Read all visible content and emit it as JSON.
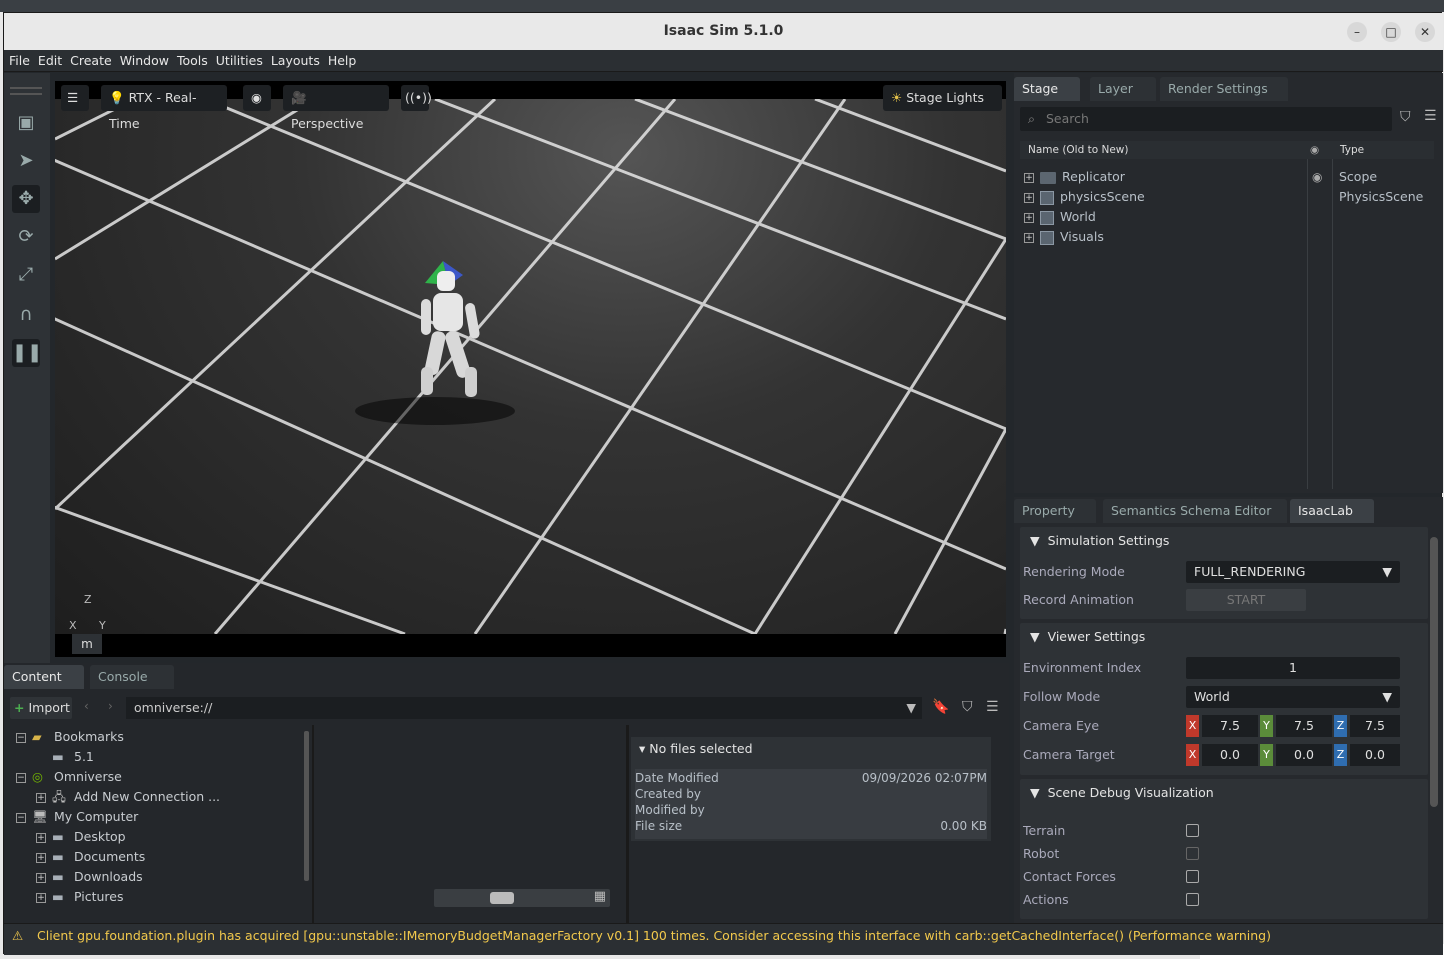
{
  "window": {
    "title": "Isaac Sim 5.1.0"
  },
  "menu": [
    "File",
    "Edit",
    "Create",
    "Window",
    "Tools",
    "Utilities",
    "Layouts",
    "Help"
  ],
  "viewport": {
    "render_mode": "RTX - Real-Time",
    "camera": "Perspective",
    "lights": "Stage Lights",
    "units": "m",
    "axes": {
      "z": "Z",
      "x": "X",
      "y": "Y"
    }
  },
  "stage": {
    "tabs": [
      "Stage",
      "Layer",
      "Render Settings"
    ],
    "search_placeholder": "Search",
    "col_name": "Name (Old to New)",
    "col_type": "Type",
    "items": [
      {
        "name": "Replicator",
        "type": "Scope",
        "icon": "folder-icon"
      },
      {
        "name": "physicsScene",
        "type": "PhysicsScene",
        "icon": "cube-icon"
      },
      {
        "name": "World",
        "type": "",
        "icon": "cube-icon"
      },
      {
        "name": "Visuals",
        "type": "",
        "icon": "cube-icon"
      }
    ]
  },
  "property": {
    "tabs": [
      "Property",
      "Semantics Schema Editor",
      "IsaacLab"
    ],
    "simulation_settings": {
      "title": "Simulation Settings",
      "rendering_mode_label": "Rendering Mode",
      "rendering_mode_value": "FULL_RENDERING",
      "record_animation_label": "Record Animation",
      "record_button": "START"
    },
    "viewer_settings": {
      "title": "Viewer Settings",
      "env_index_label": "Environment Index",
      "env_index_value": "1",
      "follow_mode_label": "Follow Mode",
      "follow_mode_value": "World",
      "camera_eye_label": "Camera Eye",
      "camera_eye": [
        "7.5",
        "7.5",
        "7.5"
      ],
      "camera_target_label": "Camera Target",
      "camera_target": [
        "0.0",
        "0.0",
        "0.0"
      ]
    },
    "scene_debug": {
      "title": "Scene Debug Visualization",
      "items": [
        "Terrain",
        "Robot",
        "Contact Forces",
        "Actions"
      ]
    }
  },
  "content": {
    "tabs": [
      "Content",
      "Console"
    ],
    "import_label": "Import",
    "path": "omniverse://",
    "tree": [
      {
        "label": "Bookmarks",
        "level": 0,
        "expander": "−",
        "icon": "bookmark-icon"
      },
      {
        "label": "5.1",
        "level": 1,
        "expander": "",
        "icon": "folder-icon"
      },
      {
        "label": "Omniverse",
        "level": 0,
        "expander": "−",
        "icon": "omniverse-icon"
      },
      {
        "label": "Add New Connection ...",
        "level": 1,
        "expander": "+",
        "icon": "connection-icon"
      },
      {
        "label": "My Computer",
        "level": 0,
        "expander": "−",
        "icon": "computer-icon"
      },
      {
        "label": "Desktop",
        "level": 1,
        "expander": "+",
        "icon": "folder-icon"
      },
      {
        "label": "Documents",
        "level": 1,
        "expander": "+",
        "icon": "folder-icon"
      },
      {
        "label": "Downloads",
        "level": 1,
        "expander": "+",
        "icon": "folder-icon"
      },
      {
        "label": "Pictures",
        "level": 1,
        "expander": "+",
        "icon": "folder-icon"
      }
    ],
    "details": {
      "header": "No files selected",
      "date_modified_label": "Date Modified",
      "date_modified_value": "09/09/2026 02:07PM",
      "created_by_label": "Created by",
      "modified_by_label": "Modified by",
      "file_size_label": "File size",
      "file_size_value": "0.00 KB"
    }
  },
  "status": {
    "message": "Client gpu.foundation.plugin has acquired [gpu::unstable::IMemoryBudgetManagerFactory v0.1] 100 times. Consider accessing this interface with carb::getCachedInterface() (Performance warning)"
  },
  "colors": {
    "warning": "#f2c94c",
    "axis_x": "#c0392b",
    "axis_y": "#5b8c3a",
    "axis_z": "#2f6db0"
  }
}
